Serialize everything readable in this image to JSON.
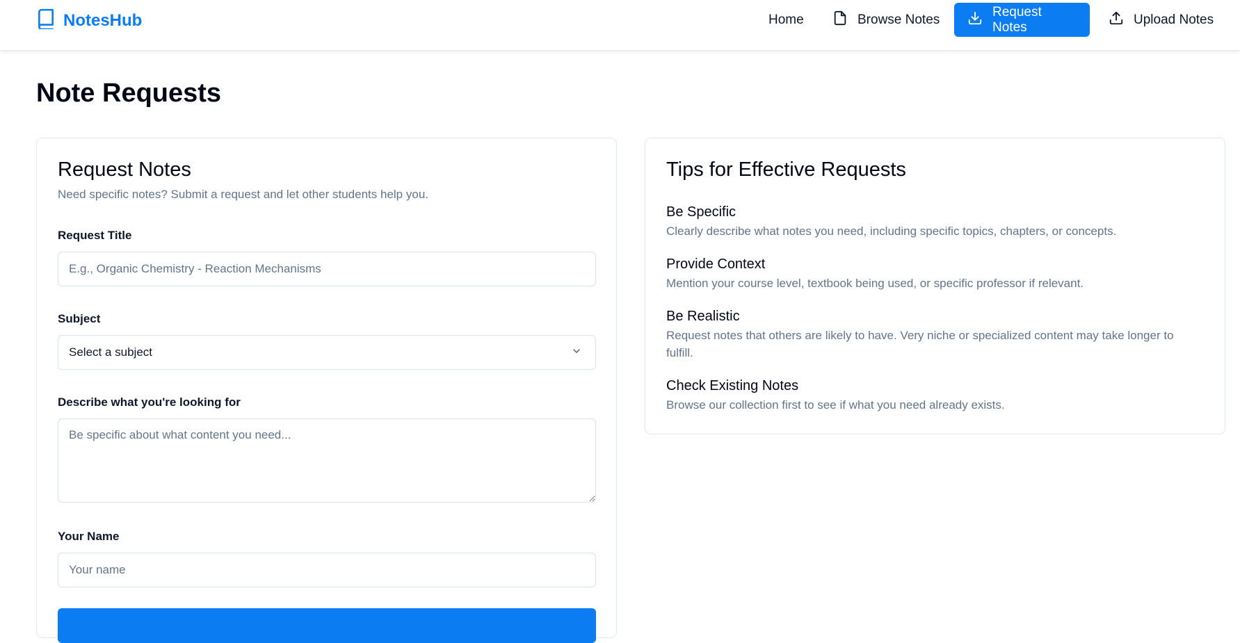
{
  "nav": {
    "brand": "NotesHub",
    "home": "Home",
    "browse": "Browse Notes",
    "request": "Request Notes",
    "upload": "Upload Notes"
  },
  "page": {
    "title": "Note Requests"
  },
  "request_form": {
    "title": "Request Notes",
    "subtitle": "Need specific notes? Submit a request and let other students help you.",
    "title_label": "Request Title",
    "title_placeholder": "E.g., Organic Chemistry - Reaction Mechanisms",
    "subject_label": "Subject",
    "subject_value": "Select a subject",
    "description_label": "Describe what you're looking for",
    "description_placeholder": "Be specific about what content you need...",
    "name_label": "Your Name",
    "name_placeholder": "Your name"
  },
  "tips": {
    "title": "Tips for Effective Requests",
    "items": [
      {
        "heading": "Be Specific",
        "text": "Clearly describe what notes you need, including specific topics, chapters, or concepts."
      },
      {
        "heading": "Provide Context",
        "text": "Mention your course level, textbook being used, or specific professor if relevant."
      },
      {
        "heading": "Be Realistic",
        "text": "Request notes that others are likely to have. Very niche or specialized content may take longer to fulfill."
      },
      {
        "heading": "Check Existing Notes",
        "text": "Browse our collection first to see if what you need already exists."
      }
    ]
  },
  "icons": {
    "brand": "book-icon",
    "browse": "file-icon",
    "request": "download-icon",
    "upload": "upload-icon",
    "select": "chevron-down-icon"
  },
  "colors": {
    "accent": "#0b7cf2",
    "muted_text": "#64748b",
    "border": "#e2e8f0"
  }
}
